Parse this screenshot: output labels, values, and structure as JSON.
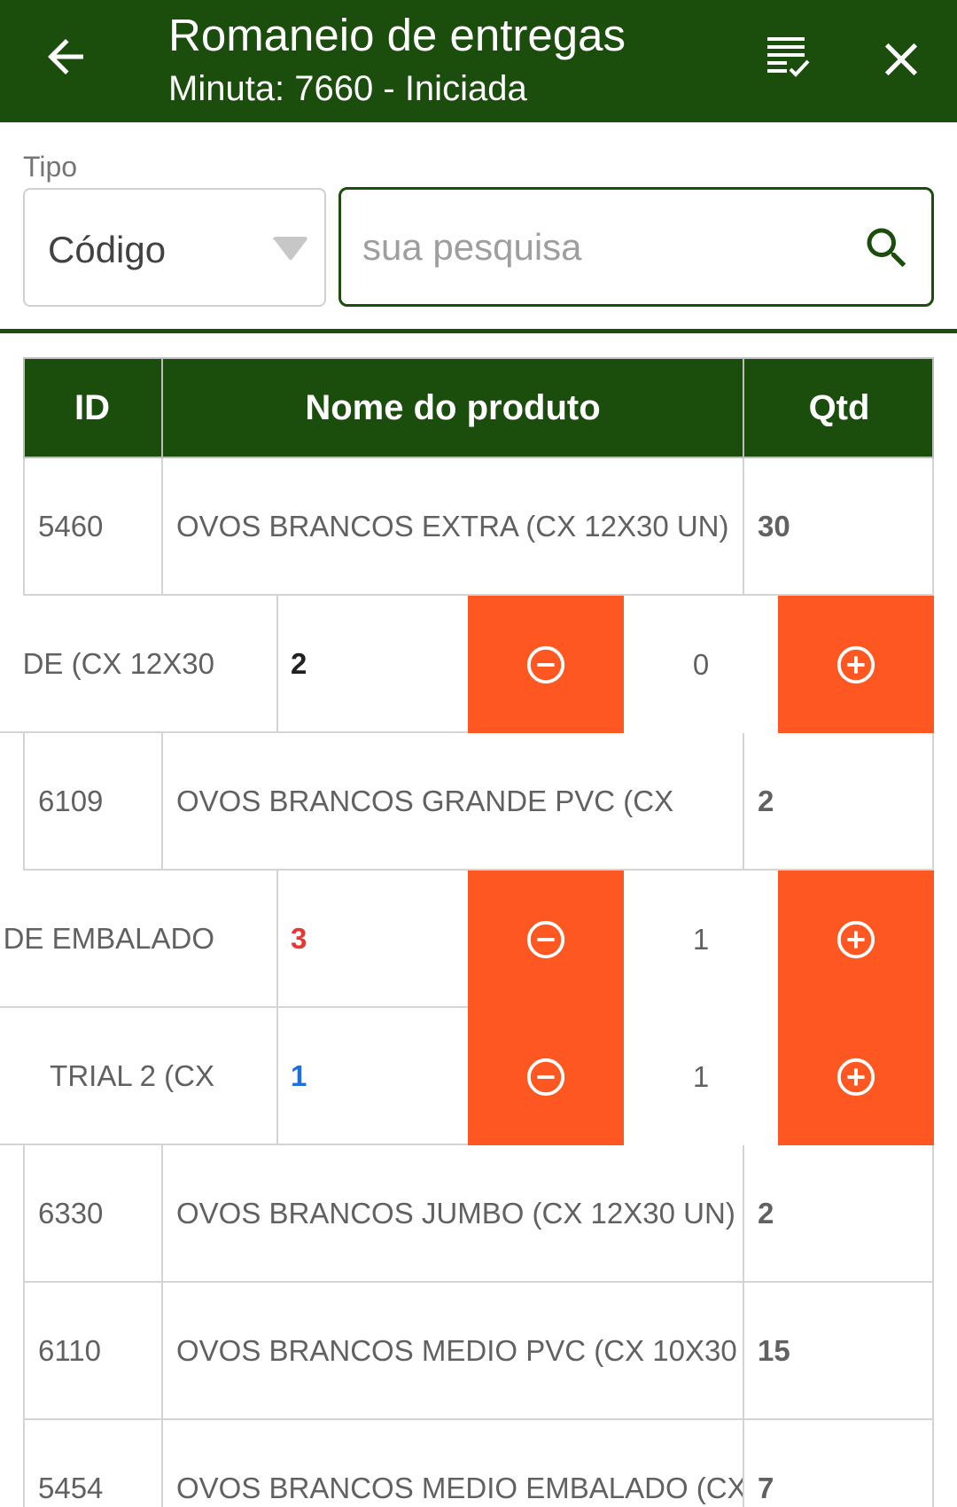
{
  "header": {
    "title": "Romaneio de entregas",
    "subtitle": "Minuta: 7660 - Iniciada",
    "icons": [
      "arrow-back-icon",
      "checklist-icon",
      "close-icon"
    ]
  },
  "filter": {
    "tipo_label": "Tipo",
    "tipo_value": "Código",
    "search_placeholder": "sua pesquisa",
    "search_value": ""
  },
  "table": {
    "columns": [
      "ID",
      "Nome do produto",
      "Qtd"
    ],
    "rows": [
      {
        "id": "5460",
        "name": "OVOS BRANCOS EXTRA  (CX 12X30 UN)",
        "qtd": "30"
      },
      {
        "name_fragment": "DE  (CX  12X30",
        "qtd": "2",
        "qtd_color": "#616161",
        "count": "0"
      },
      {
        "id": "6109",
        "name": "OVOS BRANCOS GRANDE  PVC (CX",
        "qtd": "2"
      },
      {
        "name_fragment": "DE EMBALADO",
        "qtd": "3",
        "qtd_color": "#e53935",
        "count": "1"
      },
      {
        "name_fragment": "TRIAL 2 (CX",
        "qtd": "1",
        "qtd_color": "#1e6fd9",
        "count": "1"
      },
      {
        "id": "6330",
        "name": "OVOS BRANCOS JUMBO  (CX 12X30 UN)",
        "qtd": "2"
      },
      {
        "id": "6110",
        "name": "OVOS BRANCOS MEDIO  PVC (CX  10X30",
        "qtd": "15"
      },
      {
        "id": "5454",
        "name": "OVOS BRANCOS MEDIO EMBALADO (CX",
        "qtd": "7"
      }
    ]
  },
  "colors": {
    "primary": "#1b4d0d",
    "action": "#ff5722"
  }
}
